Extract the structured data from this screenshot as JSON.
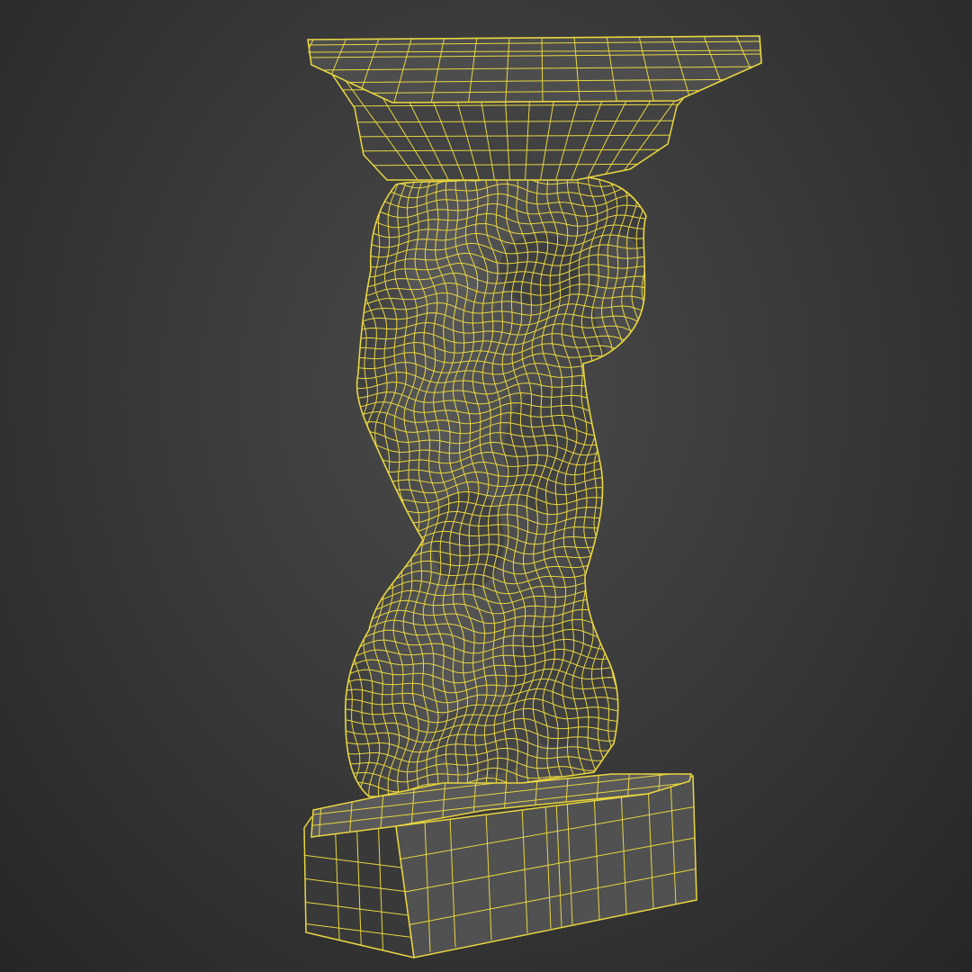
{
  "viewport": {
    "background_center": "#4a4a4a",
    "background_edge": "#262626"
  },
  "model": {
    "name": "atlas-pedestal-column",
    "display_mode": "wireframe-on-shaded",
    "wire_color": "#e8d640",
    "shade_color": "#4c4c4c",
    "shade_dark": "#383838",
    "shade_light": "#5e5e5e"
  }
}
